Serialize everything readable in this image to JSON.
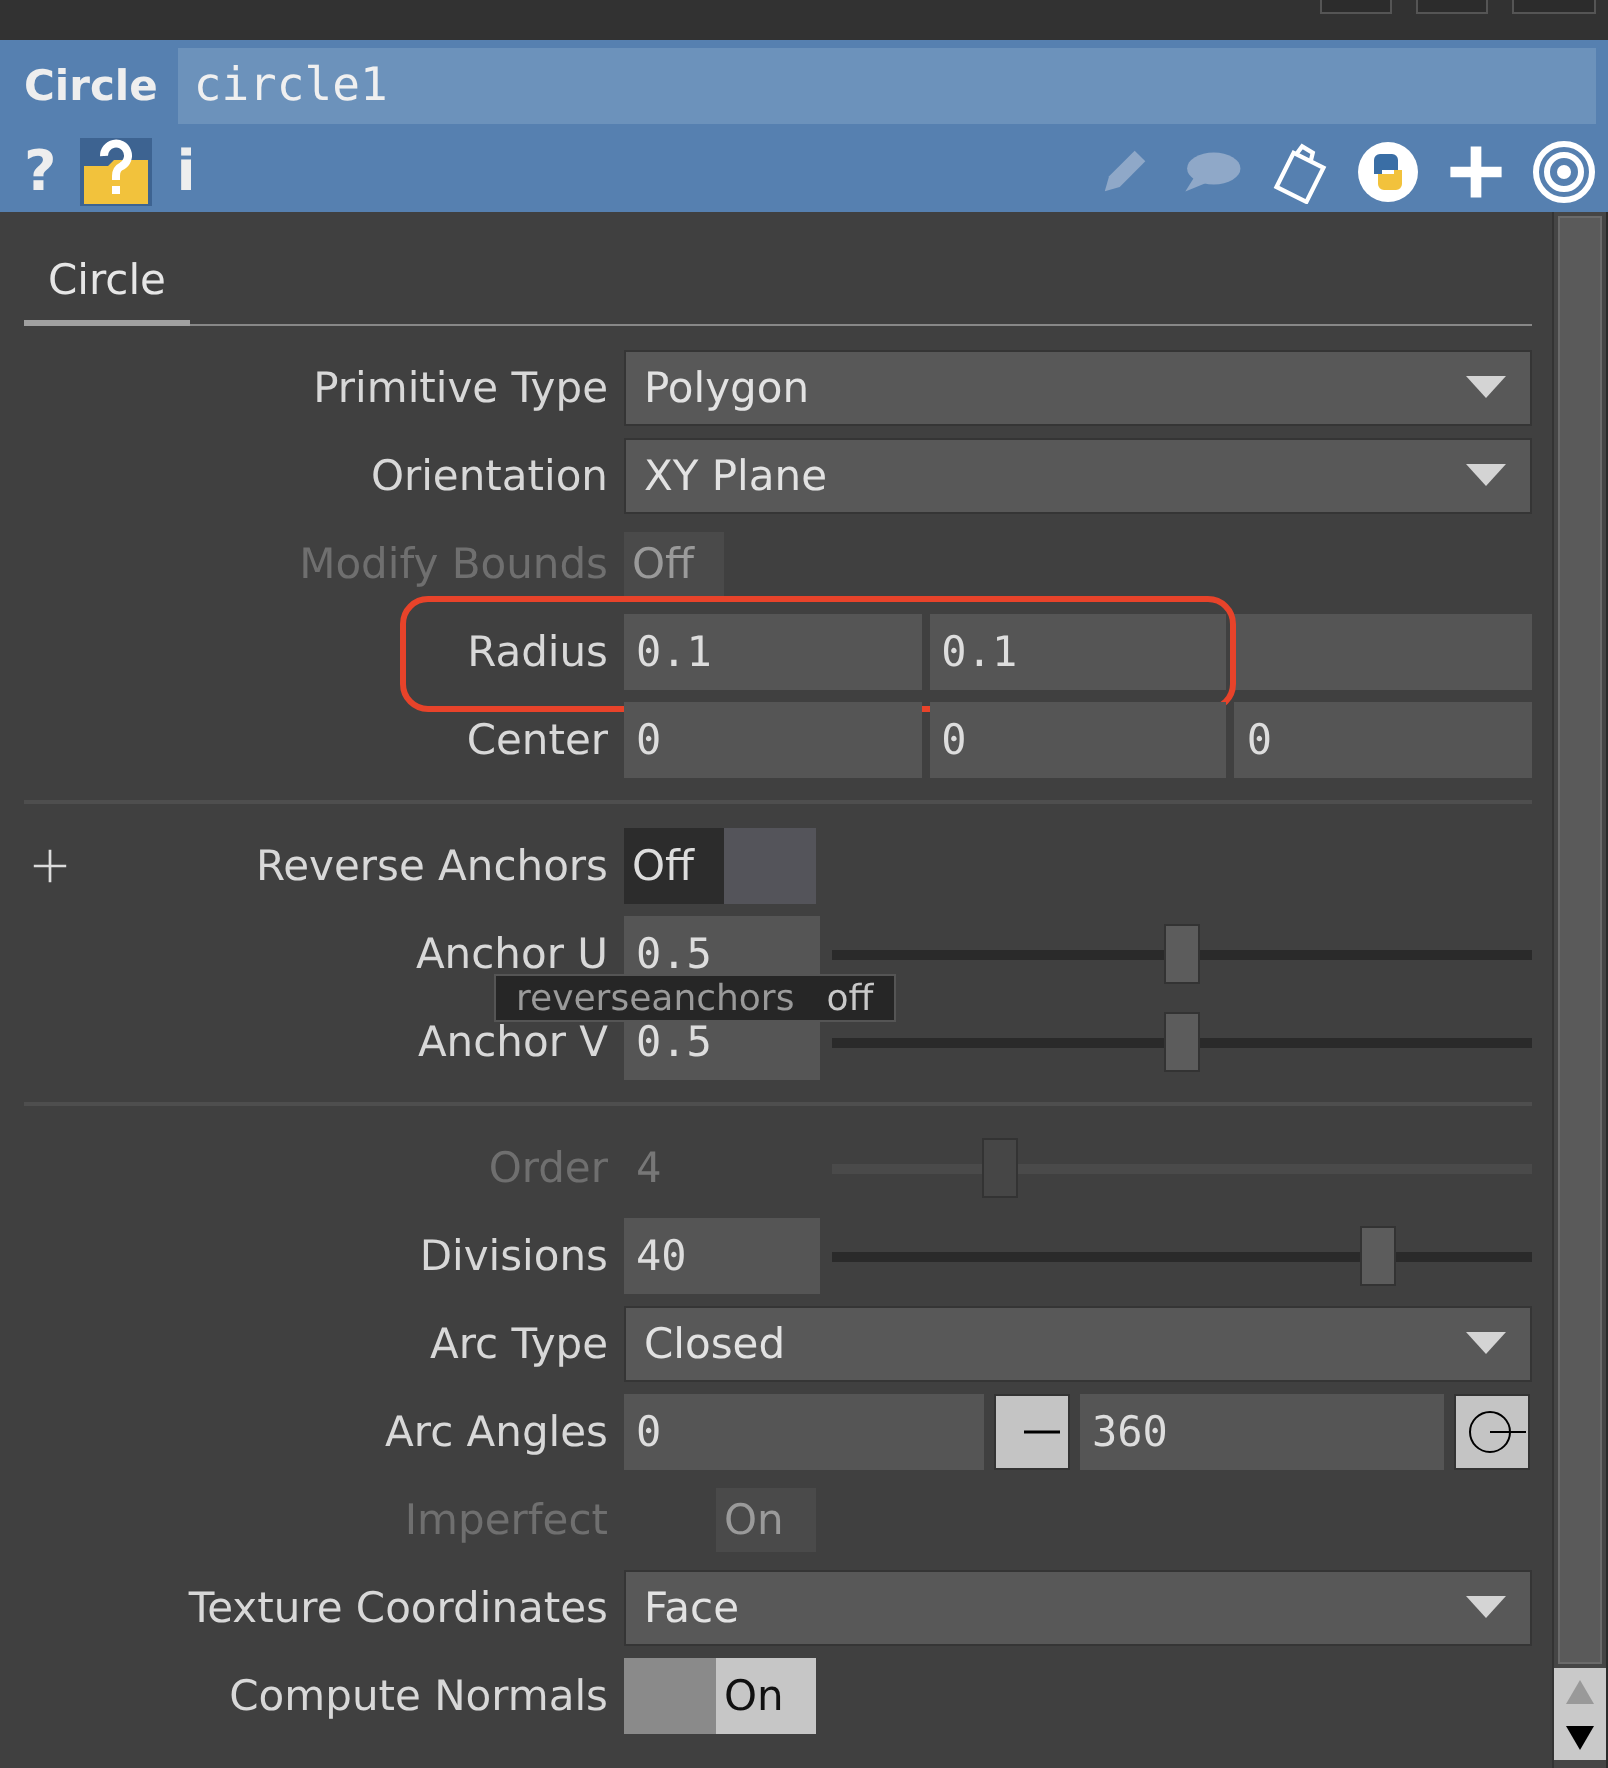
{
  "header": {
    "type": "Circle",
    "name": "circle1",
    "help_buttons": [
      {
        "glyph": "?"
      },
      {
        "glyph": "i"
      }
    ]
  },
  "tabs": [
    {
      "label": "Circle",
      "selected": true
    }
  ],
  "sections": [
    {
      "params": [
        {
          "kind": "menu",
          "label": "Primitive Type",
          "value": "Polygon",
          "disabled": false
        },
        {
          "kind": "menu",
          "label": "Orientation",
          "value": "XY Plane",
          "disabled": false
        },
        {
          "kind": "toggle",
          "label": "Modify Bounds",
          "value": "Off",
          "on": false,
          "disabled": true
        },
        {
          "kind": "float",
          "label": "Radius",
          "fields": [
            {
              "value": "0.1"
            },
            {
              "value": "0.1"
            },
            {
              "kind": "empty"
            }
          ],
          "highlighted": true,
          "disabled": false
        },
        {
          "kind": "float",
          "label": "Center",
          "fields": [
            {
              "value": "0"
            },
            {
              "value": "0"
            },
            {
              "value": "0"
            }
          ],
          "disabled": false
        }
      ]
    },
    {
      "params": [
        {
          "kind": "toggle",
          "label": "Reverse Anchors",
          "value": "Off",
          "on": false,
          "disabled": false,
          "plus": true
        },
        {
          "kind": "float",
          "label": "Anchor U",
          "fields": [
            {
              "value": "0.5"
            }
          ],
          "level": 0.5,
          "disabled": false
        },
        {
          "kind": "float",
          "label": "Anchor V",
          "fields": [
            {
              "value": "0.5"
            }
          ],
          "level": 0.5,
          "disabled": false
        }
      ]
    },
    {
      "params": [
        {
          "kind": "float",
          "label": "Order",
          "fields": [
            {
              "value": "4"
            }
          ],
          "level": 0.24,
          "disabled": true
        },
        {
          "kind": "float",
          "label": "Divisions",
          "fields": [
            {
              "value": "40"
            }
          ],
          "level": 0.78,
          "disabled": false
        },
        {
          "kind": "menu",
          "label": "Arc Type",
          "value": "Closed",
          "disabled": false
        },
        {
          "kind": "range",
          "label": "Arc Angles",
          "fields": [
            {
              "value": "0"
            },
            {
              "value": "360"
            }
          ],
          "disabled": false
        },
        {
          "kind": "toggle",
          "label": "Imperfect",
          "value": "On",
          "on": true,
          "disabled": true
        },
        {
          "kind": "menu",
          "label": "Texture Coordinates",
          "value": "Face",
          "disabled": false
        },
        {
          "kind": "toggle",
          "label": "Compute Normals",
          "value": "On",
          "on": true,
          "disabled": false
        }
      ]
    }
  ],
  "tooltip": {
    "name": "reverseanchors",
    "value": "off"
  }
}
